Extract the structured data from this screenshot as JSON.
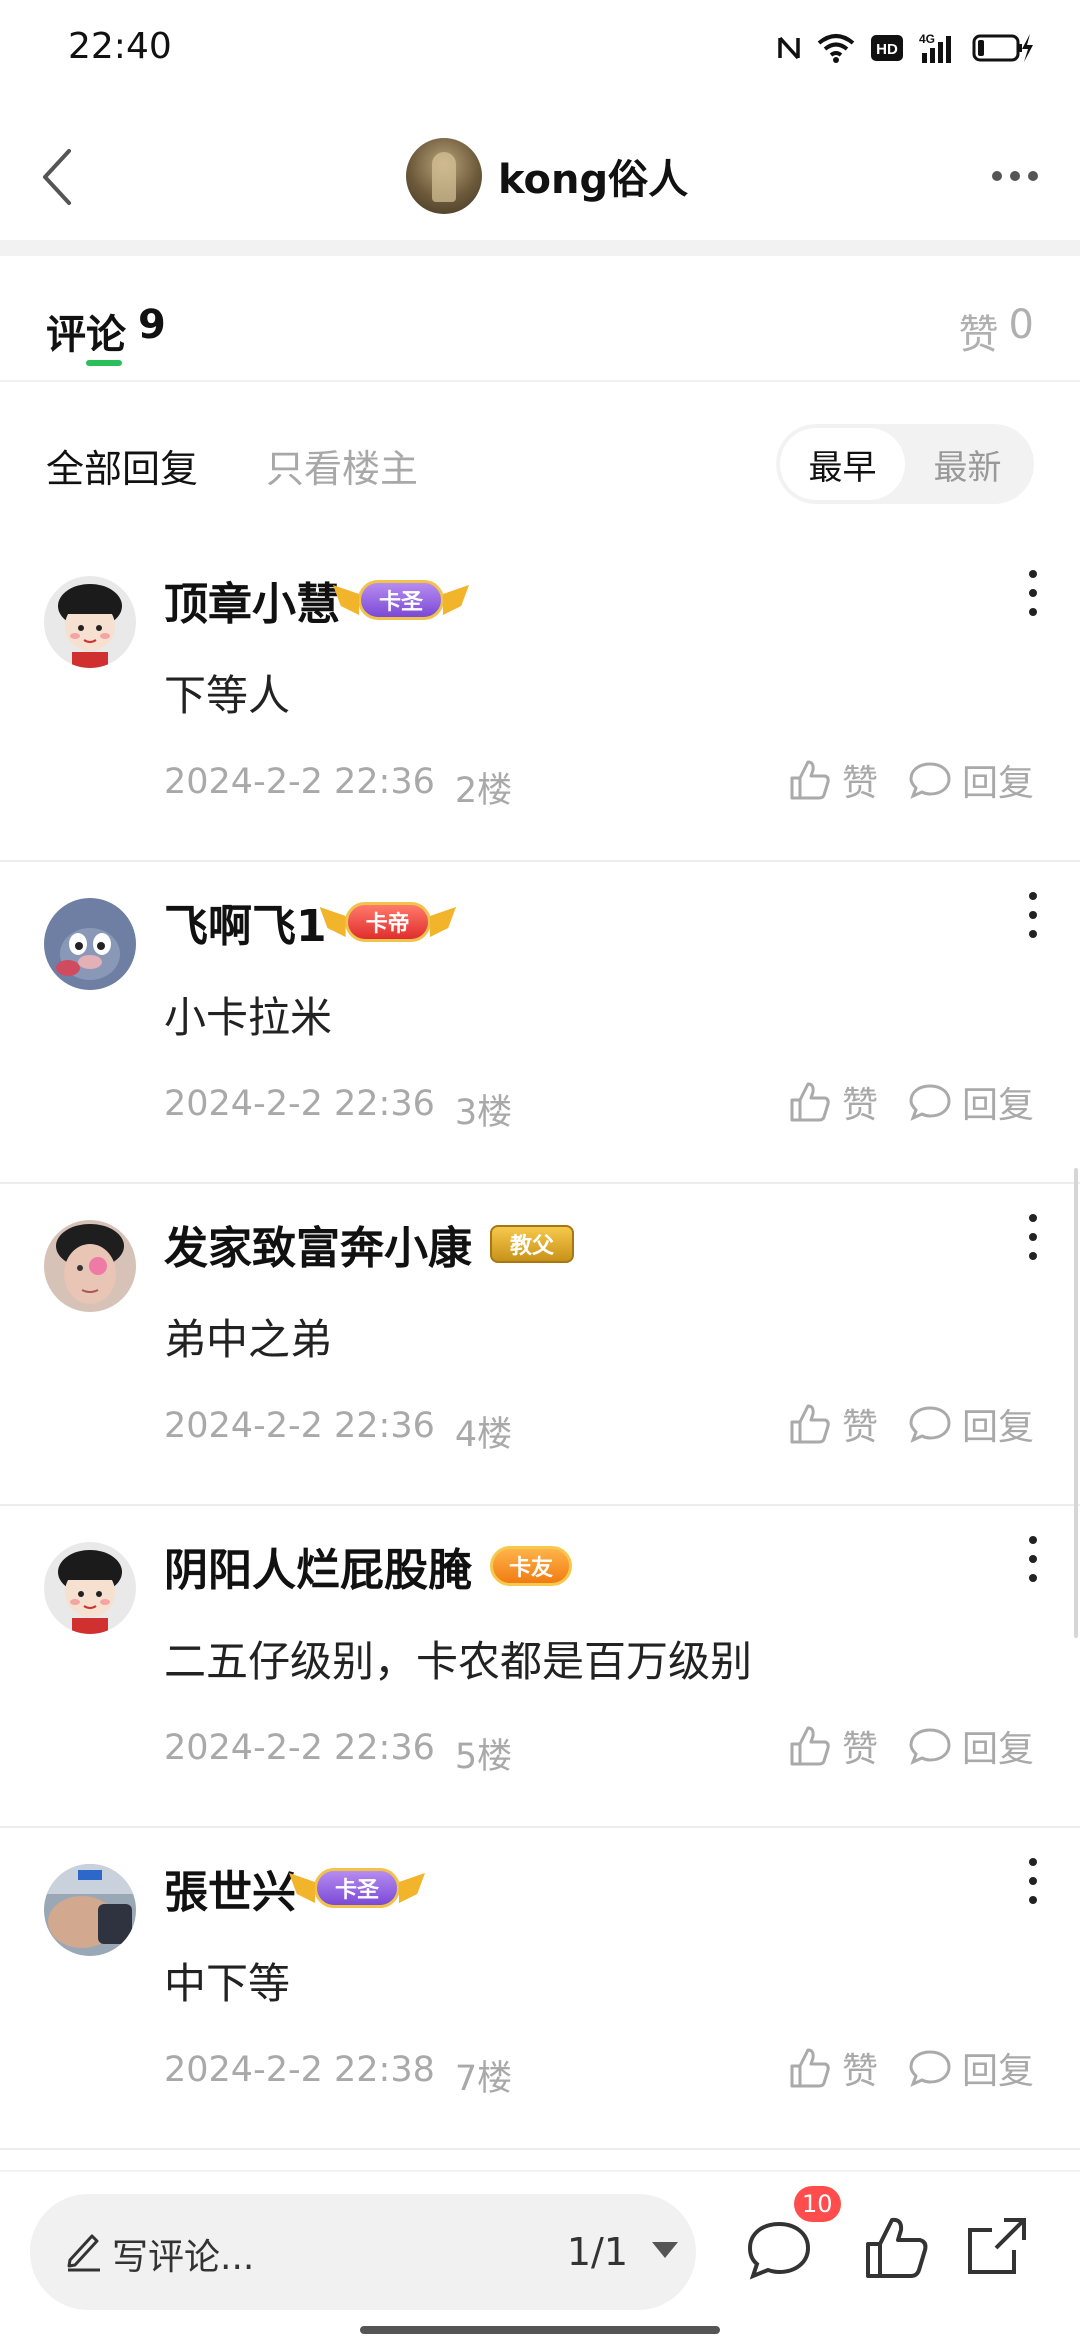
{
  "status_bar": {
    "time": "22:40",
    "icons": [
      "nfc-icon",
      "wifi-icon",
      "hd-icon",
      "4g-signal-icon",
      "battery-charging-icon"
    ],
    "hd_label": "HD",
    "network_label": "4G"
  },
  "header": {
    "title": "kong俗人",
    "back_icon": "chevron-left-icon",
    "more_icon": "more-horizontal-icon"
  },
  "tabs": {
    "comments_label": "评论",
    "comments_count": "9",
    "likes_label": "赞",
    "likes_count": "0"
  },
  "filters": {
    "all": "全部回复",
    "owner_only": "只看楼主",
    "sort_earliest": "最早",
    "sort_newest": "最新",
    "active_sort": "最早"
  },
  "comments": [
    {
      "name": "顶章小慧",
      "badge": "卡圣",
      "badge_style": "purple",
      "text": "下等人",
      "date": "2024-2-2 22:36",
      "floor": "2楼",
      "like_label": "赞",
      "reply_label": "回复"
    },
    {
      "name": "飞啊飞1",
      "badge": "卡帝",
      "badge_style": "red",
      "text": "小卡拉米",
      "date": "2024-2-2 22:36",
      "floor": "3楼",
      "like_label": "赞",
      "reply_label": "回复"
    },
    {
      "name": "发家致富奔小康",
      "badge": "教父",
      "badge_style": "gold",
      "text": "弟中之弟",
      "date": "2024-2-2 22:36",
      "floor": "4楼",
      "like_label": "赞",
      "reply_label": "回复"
    },
    {
      "name": "阴阳人烂屁股腌",
      "badge": "卡友",
      "badge_style": "orange",
      "text": "二五仔级别，卡农都是百万级别",
      "date": "2024-2-2 22:36",
      "floor": "5楼",
      "like_label": "赞",
      "reply_label": "回复"
    },
    {
      "name": "張世兴",
      "badge": "卡圣",
      "badge_style": "purple",
      "text": "中下等",
      "date": "2024-2-2 22:38",
      "floor": "7楼",
      "like_label": "赞",
      "reply_label": "回复"
    }
  ],
  "bottom_bar": {
    "write_placeholder": "写评论...",
    "page_indicator": "1/1",
    "comment_badge": "10",
    "icons": [
      "pencil-icon",
      "comment-icon",
      "thumbs-up-icon",
      "share-icon"
    ]
  },
  "colors": {
    "accent_green": "#2bbf5a",
    "badge_red": "#ff4d4d",
    "muted_text": "#a9a9a9"
  }
}
